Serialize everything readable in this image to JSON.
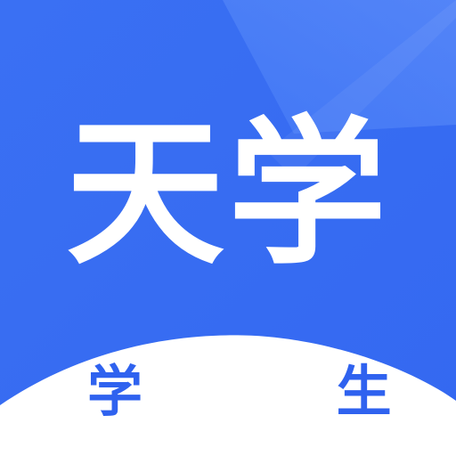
{
  "icon": {
    "title": "天学",
    "subtitle": "学 生",
    "colors": {
      "background": "#3d74f5",
      "background_highlight": "#5a8cfb",
      "background_shade": "#2d63ef",
      "title_text": "#ffffff",
      "wave": "#ffffff",
      "subtitle_text": "#2f62ef"
    }
  }
}
